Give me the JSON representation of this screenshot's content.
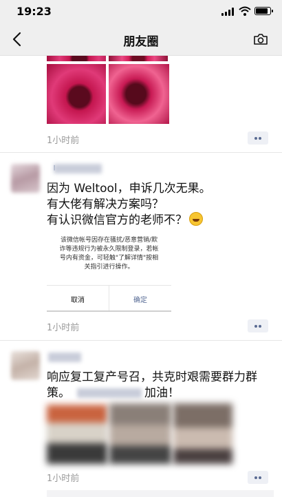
{
  "status_bar": {
    "time": "19:23"
  },
  "nav": {
    "title": "朋友圈"
  },
  "posts": [
    {
      "time": "1小时前"
    },
    {
      "lines": [
        "因为 Weltool，申诉几次无果。",
        "有大佬有解决方案吗？",
        "有认识微信官方的老师不？"
      ],
      "emoji": "grin-sweat-emoji",
      "dialog": {
        "lines": [
          "该微信帐号因存在骚扰/恶意营销/欺",
          "诈等违规行为被永久限制登录，若帐",
          "号内有资金，可轻触\"了解详情\"按相",
          "关指引进行操作。"
        ],
        "cancel": "取消",
        "confirm": "确定"
      },
      "time": "1小时前"
    },
    {
      "lines": [
        "响应复工复产号召，共克时艰需要群力群",
        "策。",
        "加油！"
      ],
      "time": "1小时前"
    }
  ],
  "colors": {
    "nickname": "#576b95",
    "confirm": "#576b95",
    "bar_bg": "#efefef"
  }
}
